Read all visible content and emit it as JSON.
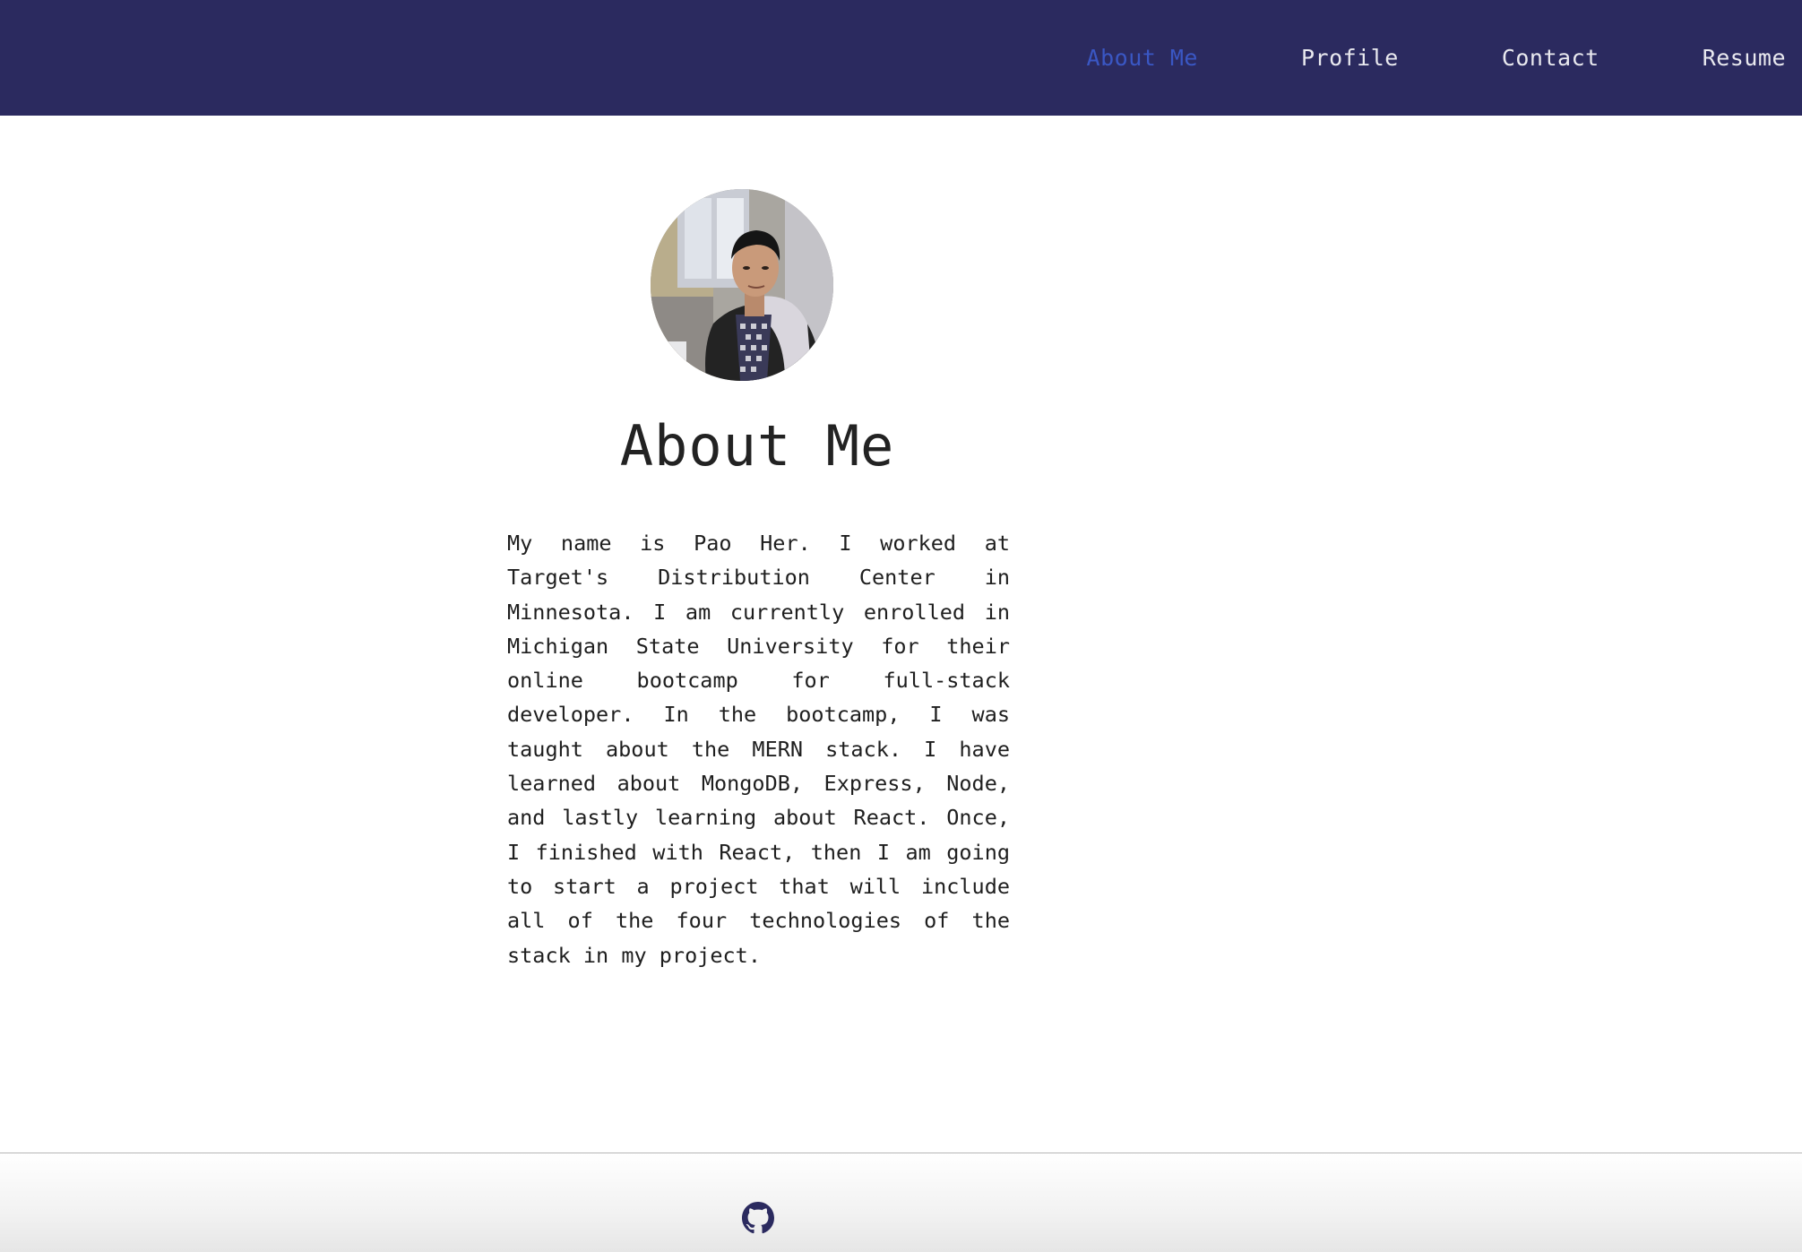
{
  "nav": {
    "items": [
      {
        "label": "About Me",
        "active": true
      },
      {
        "label": "Profile",
        "active": false
      },
      {
        "label": "Contact",
        "active": false
      },
      {
        "label": "Resume",
        "active": false
      }
    ]
  },
  "about": {
    "heading": "About Me",
    "bio": "My name is Pao Her. I worked at Target's Distribution Center in Minnesota. I am currently enrolled in Michigan State University for their online bootcamp for full-stack developer. In the bootcamp, I was taught about the MERN stack. I have learned about MongoDB, Express, Node, and lastly learning about React. Once, I finished with React, then I am going to start a project that will include all of the four technologies of the stack in my project."
  },
  "footer": {
    "icon": "github-icon"
  },
  "colors": {
    "header_bg": "#2b2a5f",
    "nav_text": "#e9e9ef",
    "nav_active": "#3a57c4",
    "text": "#222222"
  }
}
